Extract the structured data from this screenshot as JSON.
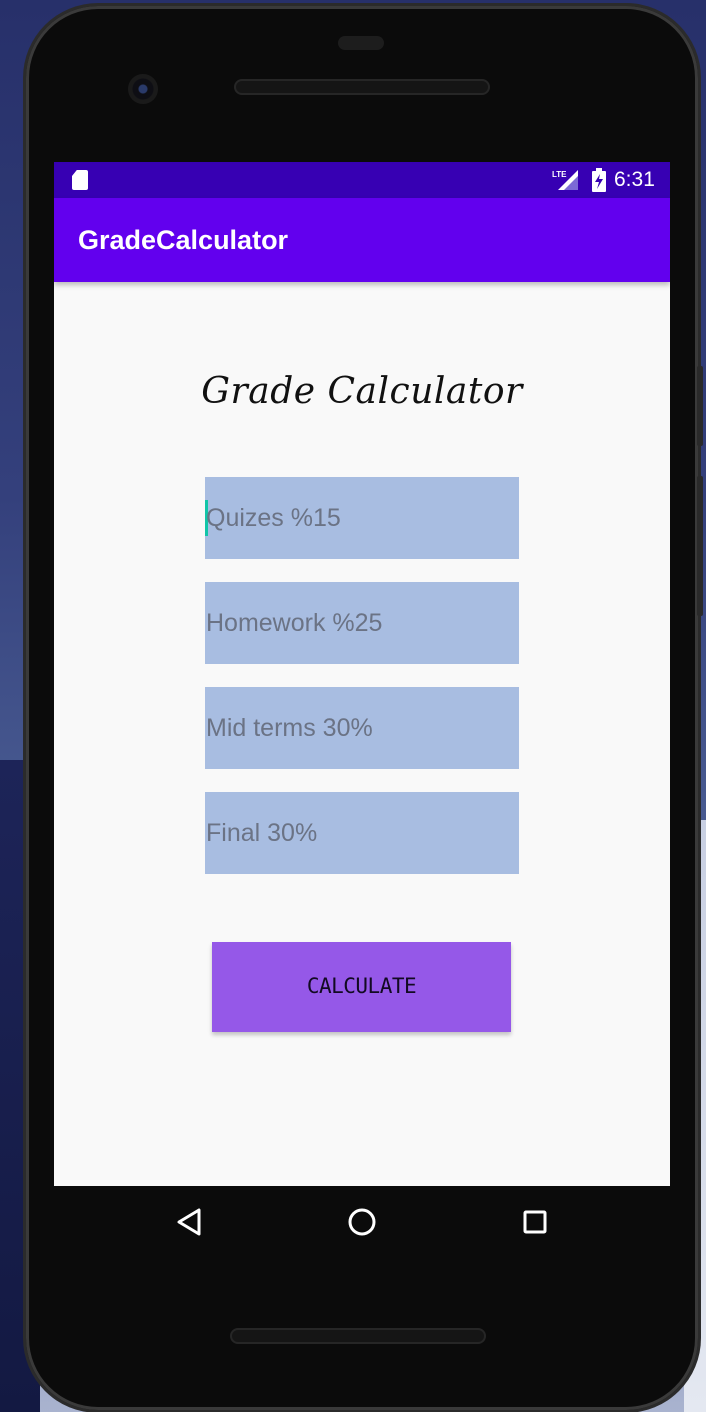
{
  "status_bar": {
    "time": "6:31",
    "network_label": "LTE",
    "icons": [
      "sd-card-icon",
      "lte-signal-icon",
      "battery-charging-icon"
    ]
  },
  "app_bar": {
    "title": "GradeCalculator"
  },
  "main": {
    "heading": "Grade Calculator",
    "fields": [
      {
        "placeholder": "Quizes %15",
        "value": "",
        "focused": true
      },
      {
        "placeholder": "Homework %25",
        "value": ""
      },
      {
        "placeholder": "Mid terms 30%",
        "value": ""
      },
      {
        "placeholder": "Final 30%",
        "value": ""
      }
    ],
    "calculate_label": "CALCULATE"
  },
  "nav_bar": {
    "icons": [
      "back-triangle-icon",
      "home-circle-icon",
      "recents-square-icon"
    ]
  },
  "colors": {
    "status_bar": "#3700b3",
    "app_bar": "#6200ee",
    "field_bg": "#a8bde1",
    "button_bg": "#9558e8",
    "cursor": "#11c5a8",
    "screen_bg": "#f9f9f9"
  }
}
